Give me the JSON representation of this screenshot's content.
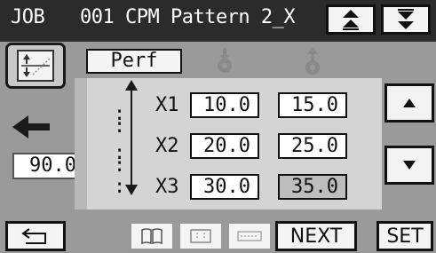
{
  "header": {
    "job_label": "JOB",
    "title": "001 CPM Pattern 2_X",
    "icons": [
      "scroll-up-icon",
      "scroll-down-icon"
    ]
  },
  "mode_icon": "layout-mode-icon",
  "perf_label": "Perf",
  "gear_icons": [
    "gear-down-icon",
    "gear-up-icon"
  ],
  "left_value": "90.0",
  "rows": [
    {
      "label": "X1",
      "a": "10.0",
      "b": "15.0"
    },
    {
      "label": "X2",
      "a": "20.0",
      "b": "25.0"
    },
    {
      "label": "X3",
      "a": "30.0",
      "b": "35.0"
    }
  ],
  "side_icons": [
    "up-triangle-icon",
    "down-triangle-icon"
  ],
  "bottom": {
    "back_icon": "back-arrow-icon",
    "view_icons": [
      "book-icon",
      "grid-icon",
      "dotted-line-icon"
    ],
    "next_label": "NEXT",
    "set_label": "SET"
  },
  "colors": {
    "header_bg": "#2b2b2b",
    "screen_bg": "#9a9a9a",
    "panel_bg": "#d4d4d4"
  }
}
